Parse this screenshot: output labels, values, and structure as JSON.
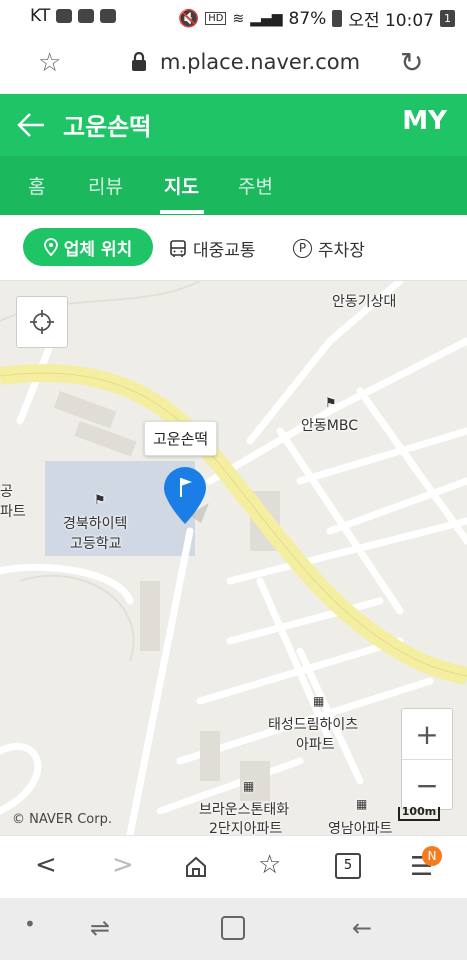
{
  "status_bar": {
    "carrier": "KT",
    "battery": "87%",
    "time": "오전 10:07",
    "sim": "1",
    "hd": "HD",
    "talk": "TALK"
  },
  "url_bar": {
    "url": "m.place.naver.com"
  },
  "header": {
    "title": "고운손떡",
    "my": "MY",
    "back_icon": "arrow-left-icon"
  },
  "tabs": [
    {
      "label": "홈",
      "active": false
    },
    {
      "label": "리뷰",
      "active": false
    },
    {
      "label": "지도",
      "active": true
    },
    {
      "label": "주변",
      "active": false
    }
  ],
  "chips": {
    "location": "업체 위치",
    "transit": "대중교통",
    "parking": "주차장",
    "parking_symbol": "P"
  },
  "map": {
    "place_name": "고운손떡",
    "labels": {
      "weather": "안동기상대",
      "mbc": "안동MBC",
      "school1": "경북하이텍",
      "school2": "고등학교",
      "apt1a": "태성드림하이츠",
      "apt1b": "아파트",
      "apt2a": "브라운스톤태화",
      "apt2b": "2단지아파트",
      "apt3": "영남아파트",
      "edge1": "공",
      "edge2": "파트"
    },
    "copyright": "© NAVER Corp.",
    "scale": "100m",
    "zoom_in": "+",
    "zoom_out": "−"
  },
  "bottom_bar": {
    "tab_count": "5",
    "badge": "N"
  },
  "colors": {
    "brand_green": "#1ec466",
    "marker_blue": "#1a7ee6",
    "badge_orange": "#f47b20"
  }
}
